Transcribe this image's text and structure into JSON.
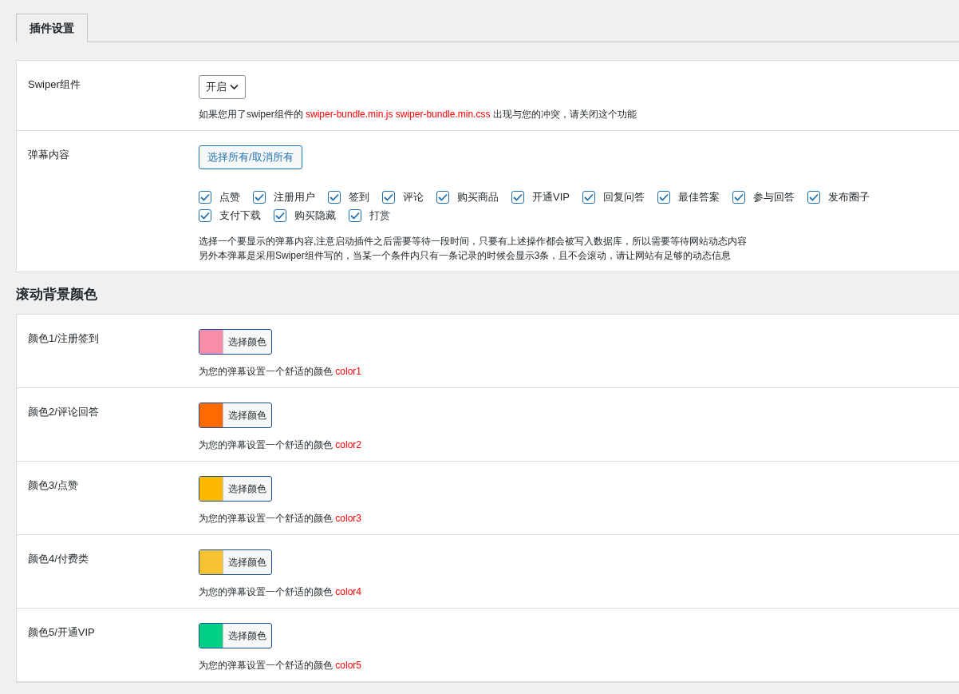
{
  "tabs": [
    {
      "label": "插件设置",
      "selected": true
    }
  ],
  "general": [
    {
      "kind": "select",
      "label": "Swiper组件",
      "value": "开启",
      "description": [
        {
          "text": "如果您用了swiper组件的 ",
          "highlight": false
        },
        {
          "text": "swiper-bundle.min.js swiper-bundle.min.css",
          "highlight": true
        },
        {
          "text": " 出现与您的冲突，请关闭这个功能",
          "highlight": false
        }
      ]
    },
    {
      "kind": "checkboxes",
      "label": "弹幕内容",
      "button": "选择所有/取消所有",
      "options": [
        {
          "label": "点赞",
          "checked": true
        },
        {
          "label": "注册用户",
          "checked": true
        },
        {
          "label": "签到",
          "checked": true
        },
        {
          "label": "评论",
          "checked": true
        },
        {
          "label": "购买商品",
          "checked": true
        },
        {
          "label": "开通VIP",
          "checked": true
        },
        {
          "label": "回复问答",
          "checked": true
        },
        {
          "label": "最佳答案",
          "checked": true
        },
        {
          "label": "参与回答",
          "checked": true
        },
        {
          "label": "发布圈子",
          "checked": true
        },
        {
          "label": "支付下载",
          "checked": true
        },
        {
          "label": "购买隐藏",
          "checked": true
        },
        {
          "label": "打赏",
          "checked": true
        }
      ],
      "notes": [
        "选择一个要显示的弹幕内容,注意启动插件之后需要等待一段时间，只要有上述操作都会被写入数据库，所以需要等待网站动态内容",
        "另外本弹幕是采用Swiper组件写的，当某一个条件内只有一条记录的时候会显示3条，且不会滚动，请让网站有足够的动态信息"
      ]
    }
  ],
  "section_title": "滚动背景颜色",
  "colors": [
    {
      "label": "颜色1/注册签到",
      "color": "#f78da7",
      "button": "选择颜色",
      "description": "为您的弹幕设置一个舒适的颜色",
      "code": "color1"
    },
    {
      "label": "颜色2/评论回答",
      "color": "#ff6900",
      "button": "选择颜色",
      "description": "为您的弹幕设置一个舒适的颜色",
      "code": "color2"
    },
    {
      "label": "颜色3/点赞",
      "color": "#fcb900",
      "button": "选择颜色",
      "description": "为您的弹幕设置一个舒适的颜色",
      "code": "color3"
    },
    {
      "label": "颜色4/付费类",
      "color": "#f6c232",
      "button": "选择颜色",
      "description": "为您的弹幕设置一个舒适的颜色",
      "code": "color4"
    },
    {
      "label": "颜色5/开通VIP",
      "color": "#00d084",
      "button": "选择颜色",
      "description": "为您的弹幕设置一个舒适的颜色",
      "code": "color5"
    }
  ]
}
